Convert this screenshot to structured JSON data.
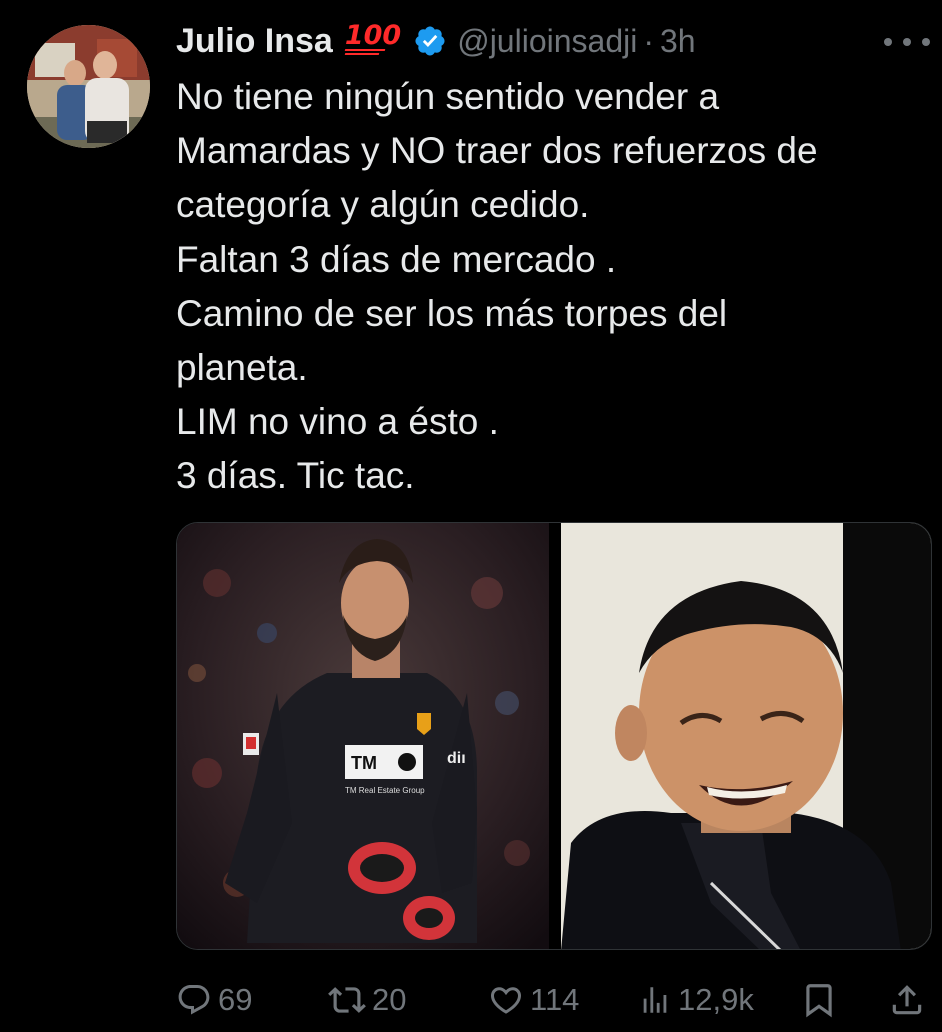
{
  "tweet": {
    "author": {
      "display_name": "Julio Insa",
      "emoji": "100",
      "handle": "@julioinsadji",
      "verified": true
    },
    "separator": "·",
    "time": "3h",
    "text_lines": [
      "No tiene ningún sentido vender a",
      "Mamardas y NO traer dos refuerzos de",
      "categoría y algún cedido.",
      "Faltan 3 días de mercado .",
      "Camino de ser los más torpes del",
      "planeta.",
      "LIM no vino a ésto .",
      "3 días. Tic tac."
    ],
    "media": {
      "left_photo": {
        "sponsor_badge": "TM",
        "sponsor_text": "TM Real Estate Group",
        "chest_text": "diı"
      }
    },
    "actions": {
      "replies": "69",
      "retweets": "20",
      "likes": "114",
      "views": "12,9k"
    }
  },
  "colors": {
    "background": "#000000",
    "text_primary": "#e7e9ea",
    "text_secondary": "#71767b",
    "verified_blue": "#1d9bf0",
    "emoji_red": "#ff2a2a"
  },
  "icons": {
    "verified": "verified-badge-icon",
    "more": "more-horizontal-icon",
    "reply": "reply-icon",
    "retweet": "retweet-icon",
    "like": "heart-icon",
    "views": "views-bar-chart-icon",
    "bookmark": "bookmark-icon",
    "share": "share-icon"
  }
}
